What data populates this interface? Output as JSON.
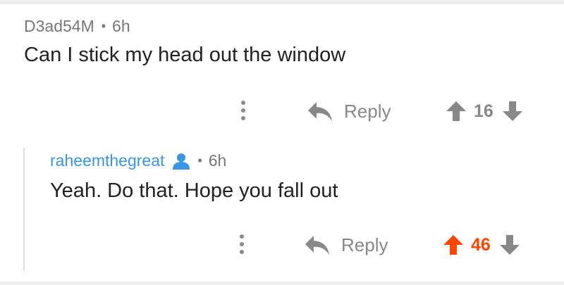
{
  "parent_comment": {
    "author": "D3ad54M",
    "separator": "•",
    "time": "6h",
    "body": "Can I stick my head out the window",
    "reply_label": "Reply",
    "score": "16",
    "upvoted": false
  },
  "child_comment": {
    "author": "raheemthegreat",
    "separator": "•",
    "time": "6h",
    "body": "Yeah. Do that. Hope you fall out",
    "reply_label": "Reply",
    "score": "46",
    "upvoted": true
  },
  "colors": {
    "upvote_active": "#ff4500",
    "neutral_gray": "#888888",
    "username_blue": "#3a95e4"
  },
  "icons": [
    "more-vertical-icon",
    "reply-arrow-icon",
    "upvote-arrow-icon",
    "downvote-arrow-icon",
    "user-icon"
  ]
}
